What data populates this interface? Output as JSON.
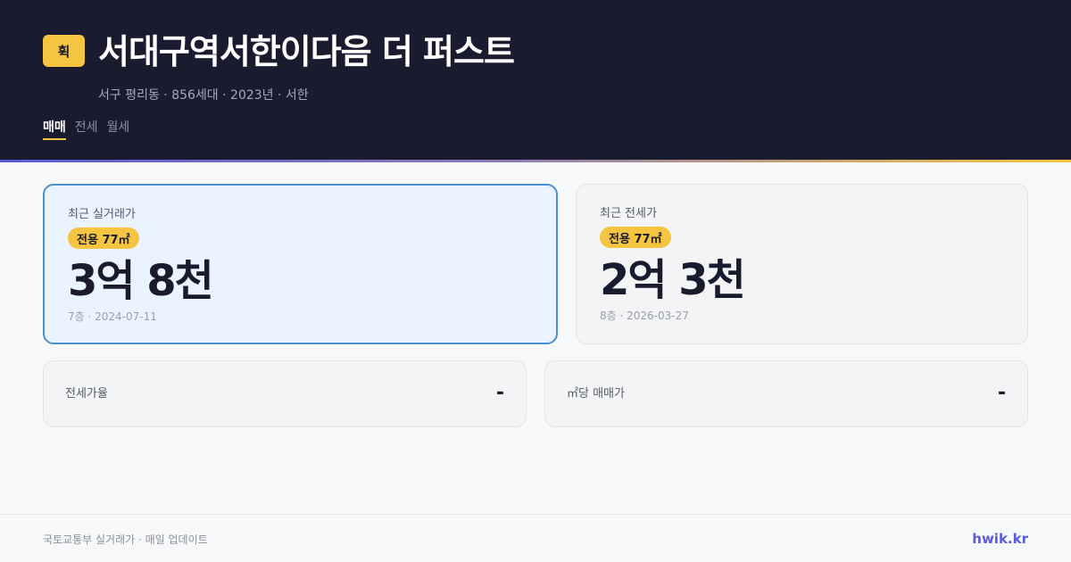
{
  "header": {
    "logo_text": "휙",
    "title": "서대구역서한이다음 더 퍼스트",
    "subtitle": "서구 평리동 · 856세대 · 2023년 · 서한",
    "tabs": [
      {
        "label": "매매",
        "active": true
      },
      {
        "label": "전세",
        "active": false
      },
      {
        "label": "월세",
        "active": false
      }
    ]
  },
  "cards": {
    "sale": {
      "label": "최근 실거래가",
      "area": "전용 77㎡",
      "price": "3억 8천",
      "meta": "7층 · 2024-07-11"
    },
    "jeonse": {
      "label": "최근 전세가",
      "area": "전용 77㎡",
      "price": "2억 3천",
      "meta": "8층 · 2026-03-27"
    }
  },
  "stats": {
    "jeonse_ratio": {
      "label": "전세가율",
      "value": "-"
    },
    "price_per_m2": {
      "label": "㎡당 매매가",
      "value": "-"
    }
  },
  "footer": {
    "source": "국토교통부 실거래가 · 매일 업데이트",
    "brand": "hwik.kr"
  },
  "colors": {
    "header_bg": "#1b1b2f",
    "accent_yellow": "#f5c542",
    "accent_blue": "#4a90cf",
    "brand_purple": "#5a5bd6"
  }
}
